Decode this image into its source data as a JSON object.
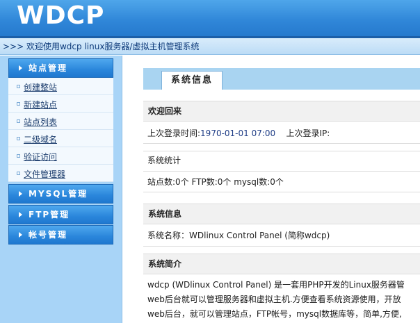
{
  "header": {
    "logo": "WDCP"
  },
  "welcome_text": ">>> 欢迎使用wdcp linux服务器/虚拟主机管理系统",
  "sidebar": {
    "menus": [
      {
        "label": "站点管理"
      },
      {
        "label": "MYSQL管理"
      },
      {
        "label": "FTP管理"
      },
      {
        "label": "帐号管理"
      }
    ],
    "site_items": [
      "创建整站",
      "新建站点",
      "站点列表",
      "二级域名",
      "验证访问",
      "文件管理器"
    ]
  },
  "main": {
    "tab_label": "系统信息",
    "welcome_head": "欢迎回来",
    "last_login_label": "上次登录时间:",
    "last_login_value": "1970-01-01 07:00",
    "last_ip_label": "上次登录IP:",
    "stats_title": "系统统计",
    "stats_line": "站点数:0个   FTP数:0个   mysql数:0个",
    "sysinfo_head": "系统信息",
    "sysname_line": "系统名称：WDlinux Control Panel (简称wdcp)",
    "intro_head": "系统简介",
    "intro_lines": [
      "wdcp (WDlinux Control Panel) 是一套用PHP开发的Linux服务器管",
      "web后台就可以管理服务器和虚拟主机.方便查看系统资源使用，开放",
      "web后台，就可以管理站点，FTP帐号，mysql数据库等，简单,方便,"
    ]
  }
}
